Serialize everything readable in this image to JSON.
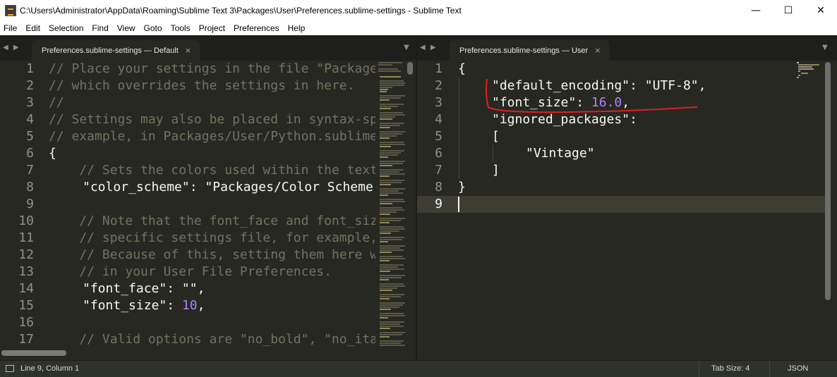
{
  "window": {
    "title": "C:\\Users\\Administrator\\AppData\\Roaming\\Sublime Text 3\\Packages\\User\\Preferences.sublime-settings - Sublime Text",
    "minimize_glyph": "—",
    "maximize_glyph": "☐",
    "close_glyph": "✕"
  },
  "menu": [
    "File",
    "Edit",
    "Selection",
    "Find",
    "View",
    "Goto",
    "Tools",
    "Project",
    "Preferences",
    "Help"
  ],
  "left_pane": {
    "nav_arrows": "◀ ▶",
    "tab_label": "Preferences.sublime-settings — Default",
    "tab_close": "×",
    "dropdown_glyph": "▼",
    "line_numbers": [
      "1",
      "2",
      "3",
      "4",
      "5",
      "6",
      "7",
      "8",
      "9",
      "10",
      "11",
      "12",
      "13",
      "14",
      "15",
      "16",
      "17"
    ],
    "lines": {
      "l1": "// Place your settings in the file \"Packages/User/Preferences.sublime-settings\",",
      "l2": "// which overrides the settings in here.",
      "l3": "//",
      "l4": "// Settings may also be placed in syntax-specific setting files, for",
      "l5": "// example, in Packages/User/Python.sublime-settings for python files.",
      "l6": "{",
      "l7": "    // Sets the colors used within the text area",
      "l8_key": "\"color_scheme\"",
      "l8_colon": ": ",
      "l8_val": "\"Packages/Color Scheme - Default/Monokai.tmTheme\",",
      "l9": "",
      "l10": "    // Note that the font_face and font_size are overridden in the platform",
      "l11": "    // specific settings file, for example, \"Preferences (Linux).sublime-settings\".",
      "l12": "    // Because of this, setting them here will have no effect: you must set them",
      "l13": "    // in your User File Preferences.",
      "l14_key": "\"font_face\"",
      "l14_colon": ": ",
      "l14_val": "\"\",",
      "l15_key": "\"font_size\"",
      "l15_colon": ": ",
      "l15_val": "10",
      "l15_end": ",",
      "l16": "",
      "l17": "    // Valid options are \"no_bold\", \"no_italic\", \"no_antialias\", \"gray_antialias\","
    }
  },
  "right_pane": {
    "nav_arrows": "◀ ▶",
    "tab_label": "Preferences.sublime-settings — User",
    "tab_close": "×",
    "dropdown_glyph": "▼",
    "line_numbers": [
      "1",
      "2",
      "3",
      "4",
      "5",
      "6",
      "7",
      "8",
      "9"
    ],
    "lines": {
      "l1": "{",
      "l2_key": "\"default_encoding\"",
      "l2_colon": ": ",
      "l2_val": "\"UTF-8\"",
      "l2_end": ",",
      "l3_key": "\"font_size\"",
      "l3_colon": ": ",
      "l3_val": "16.0",
      "l3_end": ",",
      "l4_key": "\"ignored_packages\"",
      "l4_colon": ":",
      "l5": "[",
      "l6_val": "\"Vintage\"",
      "l7": "]",
      "l8": "}",
      "l9": ""
    },
    "active_line": 9
  },
  "status": {
    "position": "Line 9, Column 1",
    "tab_size": "Tab Size: 4",
    "syntax": "JSON"
  },
  "colors": {
    "editor_bg": "#272822",
    "comment": "#75715e",
    "string": "#e6db74",
    "number": "#ae81ff",
    "annotation": "#e02020"
  }
}
